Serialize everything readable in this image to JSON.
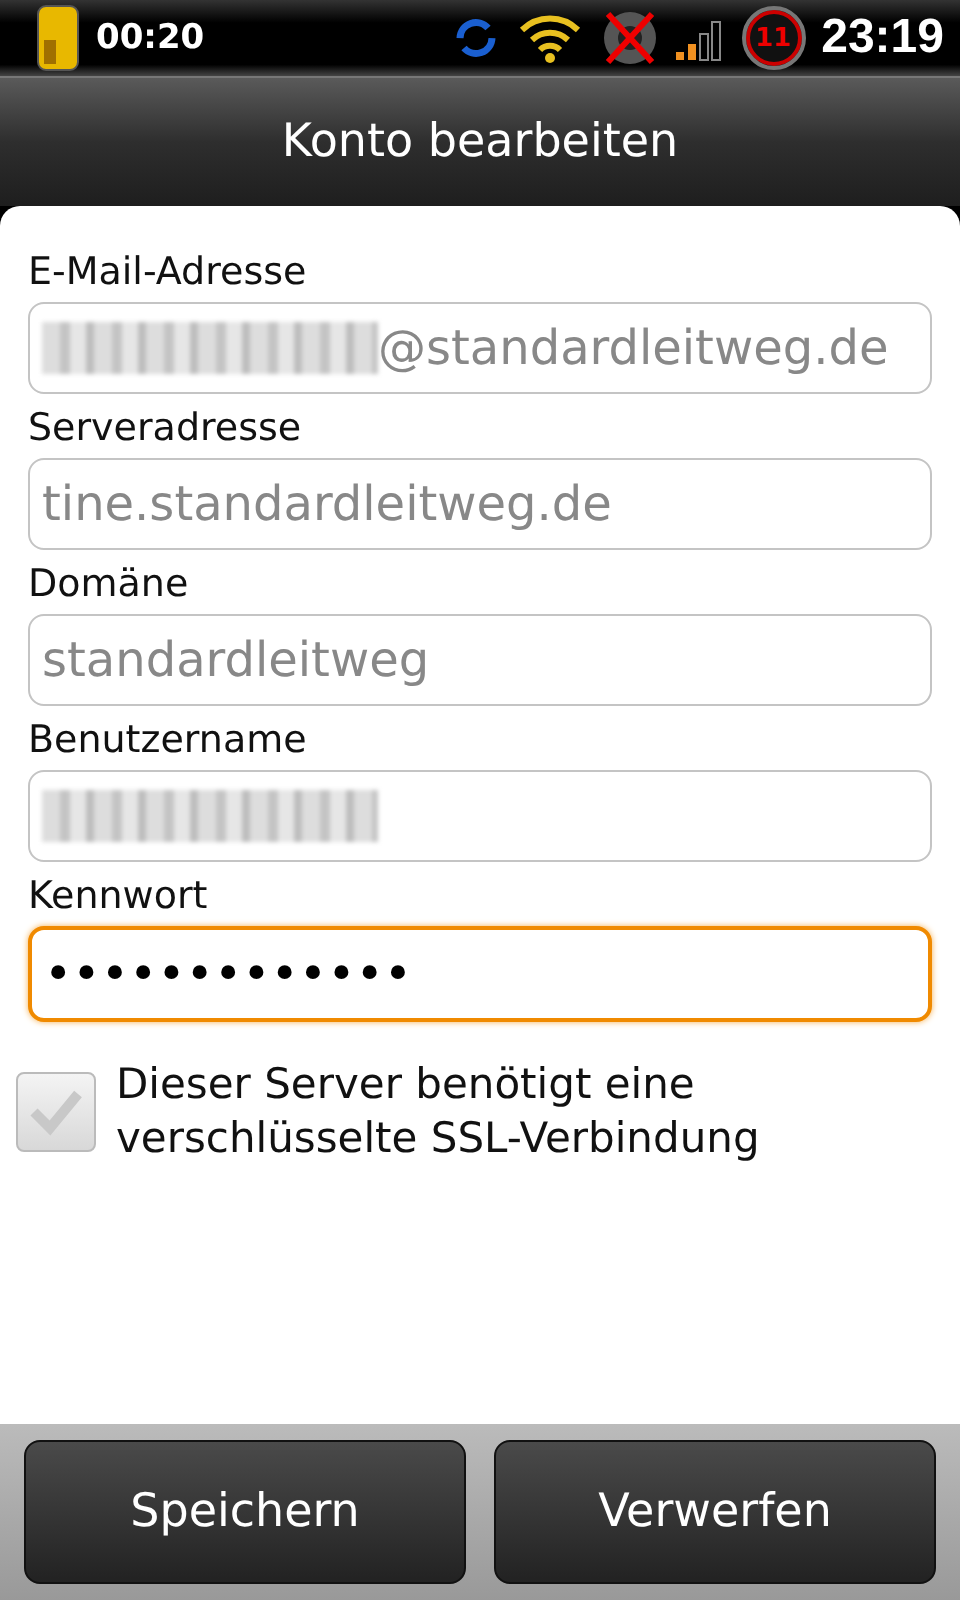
{
  "status_bar": {
    "timer": "00:20",
    "badge": "11",
    "time": "23:19"
  },
  "title": "Konto bearbeiten",
  "fields": [
    {
      "label": "E-Mail-Adresse",
      "value": "@standardleitweg.de",
      "redacted": true,
      "disabled": true,
      "focused": false
    },
    {
      "label": "Serveradresse",
      "value": "tine.standardleitweg.de",
      "redacted": false,
      "disabled": true,
      "focused": false
    },
    {
      "label": "Domäne",
      "value": "standardleitweg",
      "redacted": false,
      "disabled": true,
      "focused": false
    },
    {
      "label": "Benutzername",
      "redacted": true,
      "disabled": true,
      "focused": false
    },
    {
      "label": "Kennwort",
      "value": "•••••••••••••",
      "redacted": false,
      "disabled": false,
      "focused": true
    }
  ],
  "ssl_checkbox": {
    "label": "Dieser Server benötigt eine verschlüsselte SSL-Verbindung",
    "checked": false
  },
  "buttons": [
    "Speichern",
    "Verwerfen"
  ]
}
